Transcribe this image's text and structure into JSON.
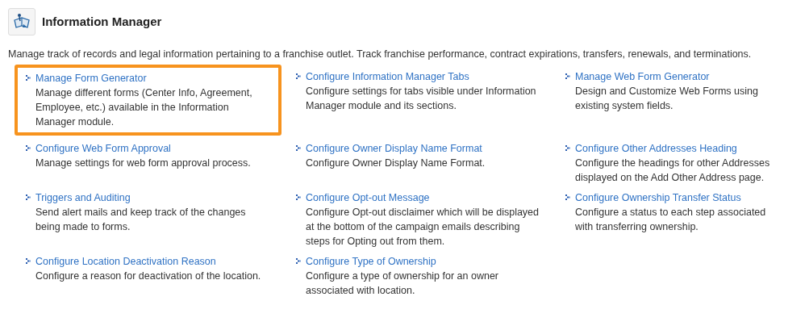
{
  "header": {
    "title": "Information Manager"
  },
  "intro": "Manage track of records and legal information pertaining to a franchise outlet. Track franchise performance, contract expirations, transfers, renewals, and terminations.",
  "items": [
    {
      "link": "Manage Form Generator",
      "description": "Manage different forms (Center Info, Agreement, Employee, etc.) available in the Information Manager module.",
      "highlighted": true
    },
    {
      "link": "Configure Information Manager Tabs",
      "description": "Configure settings for tabs visible under Information Manager module and its sections.",
      "highlighted": false
    },
    {
      "link": "Manage Web Form Generator",
      "description": "Design and Customize Web Forms using existing system fields.",
      "highlighted": false
    },
    {
      "link": "Configure Web Form Approval",
      "description": "Manage settings for web form approval process.",
      "highlighted": false
    },
    {
      "link": "Configure Owner Display Name Format",
      "description": "Configure Owner Display Name Format.",
      "highlighted": false
    },
    {
      "link": "Configure Other Addresses Heading",
      "description": "Configure the headings for other Addresses displayed on the Add Other Address page.",
      "highlighted": false
    },
    {
      "link": "Triggers and Auditing",
      "description": "Send alert mails and keep track of the changes being made to forms.",
      "highlighted": false
    },
    {
      "link": "Configure Opt-out Message",
      "description": "Configure Opt-out disclaimer which will be displayed at the bottom of the campaign emails describing steps for Opting out from them.",
      "highlighted": false
    },
    {
      "link": "Configure Ownership Transfer Status",
      "description": "Configure a status to each step associated with transferring ownership.",
      "highlighted": false
    },
    {
      "link": "Configure Location Deactivation Reason",
      "description": "Configure a reason for deactivation of the location.",
      "highlighted": false
    },
    {
      "link": "Configure Type of Ownership",
      "description": "Configure a type of ownership for an owner associated with location.",
      "highlighted": false
    }
  ]
}
